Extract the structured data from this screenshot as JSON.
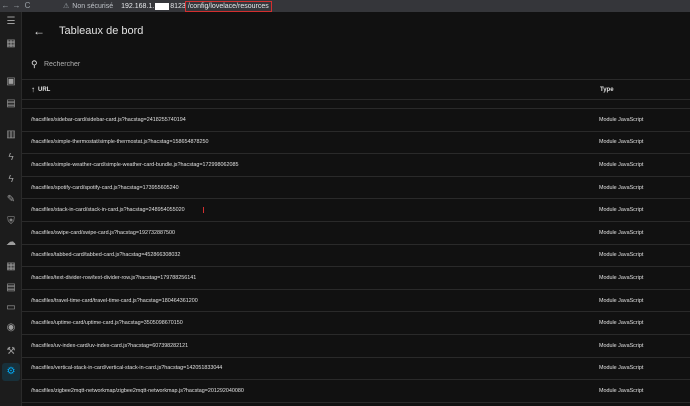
{
  "browser": {
    "back": "←",
    "forward": "→",
    "reload": "C",
    "security_warning": "Non sécurisé",
    "host_prefix": "192.168.1.",
    "port": "8123",
    "path": "/config/lovelace/resources"
  },
  "sidebar": {
    "items": [
      {
        "icon": "menu-icon",
        "glyph": "☰"
      },
      {
        "icon": "dashboard-icon",
        "glyph": "▦"
      },
      {
        "icon": "calendar-icon",
        "glyph": "▣"
      },
      {
        "icon": "logbook-icon",
        "glyph": "▤"
      },
      {
        "icon": "history-icon",
        "glyph": "▥"
      },
      {
        "icon": "lightning-icon",
        "glyph": "ϟ"
      },
      {
        "icon": "lightning-icon",
        "glyph": "ϟ"
      },
      {
        "icon": "wrench-icon",
        "glyph": "✎"
      },
      {
        "icon": "shield-icon",
        "glyph": "⛨"
      },
      {
        "icon": "cloud-icon",
        "glyph": "☁"
      },
      {
        "icon": "grid-icon",
        "glyph": "▦"
      },
      {
        "icon": "list-icon",
        "glyph": "▤"
      },
      {
        "icon": "server-icon",
        "glyph": "▭"
      },
      {
        "icon": "compass-icon",
        "glyph": "◉"
      },
      {
        "icon": "hammer-icon",
        "glyph": "⚒"
      },
      {
        "icon": "settings-icon",
        "glyph": "⚙"
      }
    ],
    "active_index": 15
  },
  "header": {
    "title": "Tableaux de bord"
  },
  "search": {
    "placeholder": "Rechercher"
  },
  "table": {
    "columns": {
      "url": "URL",
      "type": "Type"
    },
    "rows": [
      {
        "url": "/hacsfiles/sidebar-card/sidebar-card.js?hacstag=2418255740194",
        "type": "Module JavaScript"
      },
      {
        "url": "/hacsfiles/simple-thermostat/simple-thermostat.js?hacstag=158654878250",
        "type": "Module JavaScript"
      },
      {
        "url": "/hacsfiles/simple-weather-card/simple-weather-card-bundle.js?hacstag=172998062085",
        "type": "Module JavaScript"
      },
      {
        "url": "/hacsfiles/spotify-card/spotify-card.js?hacstag=173955605240",
        "type": "Module JavaScript"
      },
      {
        "url": "/hacsfiles/stack-in-card/stack-in-card.js?hacstag=248954055020",
        "type": "Module JavaScript",
        "highlight": true
      },
      {
        "url": "/hacsfiles/swipe-card/swipe-card.js?hacstag=192732887500",
        "type": "Module JavaScript"
      },
      {
        "url": "/hacsfiles/tabbed-card/tabbed-card.js?hacstag=452866308032",
        "type": "Module JavaScript"
      },
      {
        "url": "/hacsfiles/text-divider-row/text-divider-row.js?hacstag=179788256141",
        "type": "Module JavaScript"
      },
      {
        "url": "/hacsfiles/travel-time-card/travel-time-card.js?hacstag=180464361200",
        "type": "Module JavaScript"
      },
      {
        "url": "/hacsfiles/uptime-card/uptime-card.js?hacstag=3505098670150",
        "type": "Module JavaScript"
      },
      {
        "url": "/hacsfiles/uv-index-card/uv-index-card.js?hacstag=607398282121",
        "type": "Module JavaScript"
      },
      {
        "url": "/hacsfiles/vertical-stack-in-card/vertical-stack-in-card.js?hacstag=142051833044",
        "type": "Module JavaScript"
      },
      {
        "url": "/hacsfiles/zigbee2mqtt-networkmap/zigbee2mqtt-networkmap.js?hacstag=201292040080",
        "type": "Module JavaScript"
      }
    ]
  },
  "colors": {
    "accent": "#03a9f4",
    "highlight_box": "#d32f2f",
    "background": "#111111"
  }
}
